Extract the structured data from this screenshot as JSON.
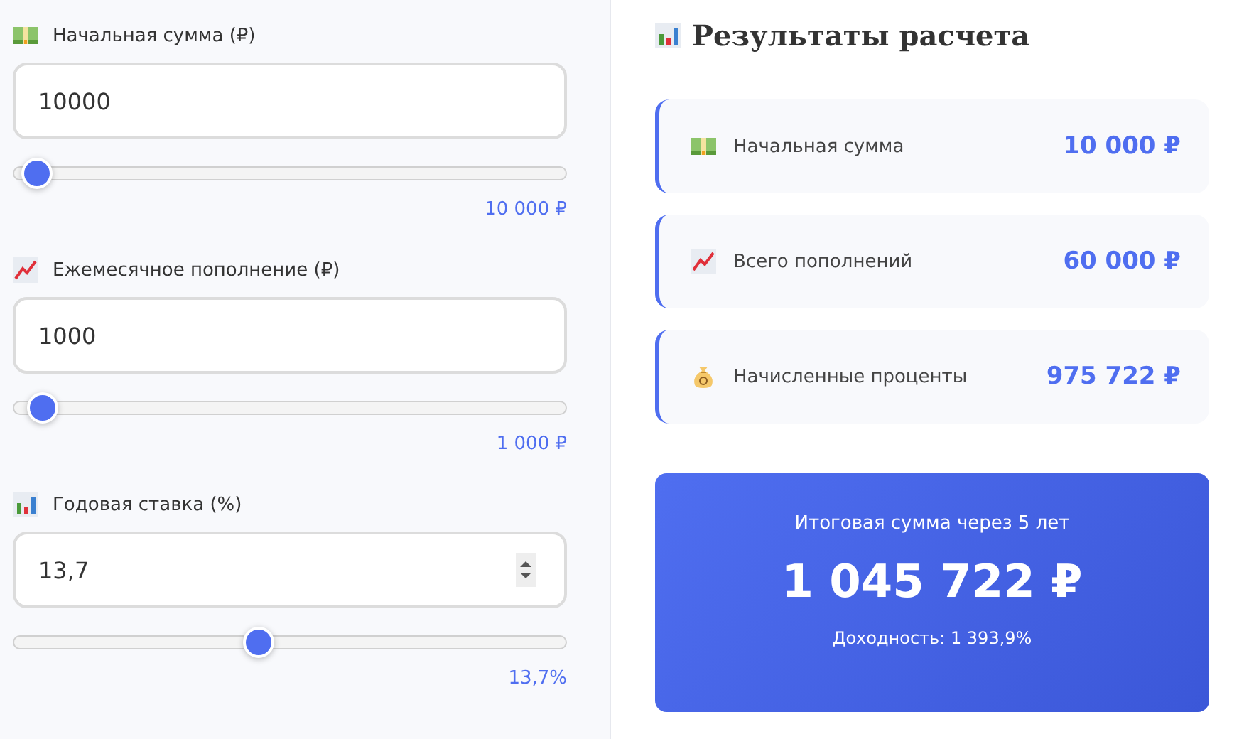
{
  "inputs": [
    {
      "label": "Начальная сумма (₽)",
      "value": "10000",
      "spinner": false,
      "level": 0.02,
      "reading": "10 000 ₽"
    },
    {
      "label": "Ежемесячное пополнение (₽)",
      "value": "1000",
      "spinner": false,
      "level": 0.03,
      "reading": "1 000 ₽"
    },
    {
      "label": "Годовая ставка (%)",
      "value": "13,7",
      "spinner": true,
      "level": 0.44,
      "reading": "13,7%"
    }
  ],
  "results": {
    "title": "Результаты расчета",
    "items": [
      {
        "label": "Начальная сумма",
        "value": "10 000 ₽"
      },
      {
        "label": "Всего пополнений",
        "value": "60 000 ₽"
      },
      {
        "label": "Начисленные проценты",
        "value": "975 722 ₽"
      }
    ],
    "total": {
      "caption": "Итоговая сумма через 5 лет",
      "amount": "1 045 722 ₽",
      "yield": "Доходность: 1 393,9%"
    }
  }
}
